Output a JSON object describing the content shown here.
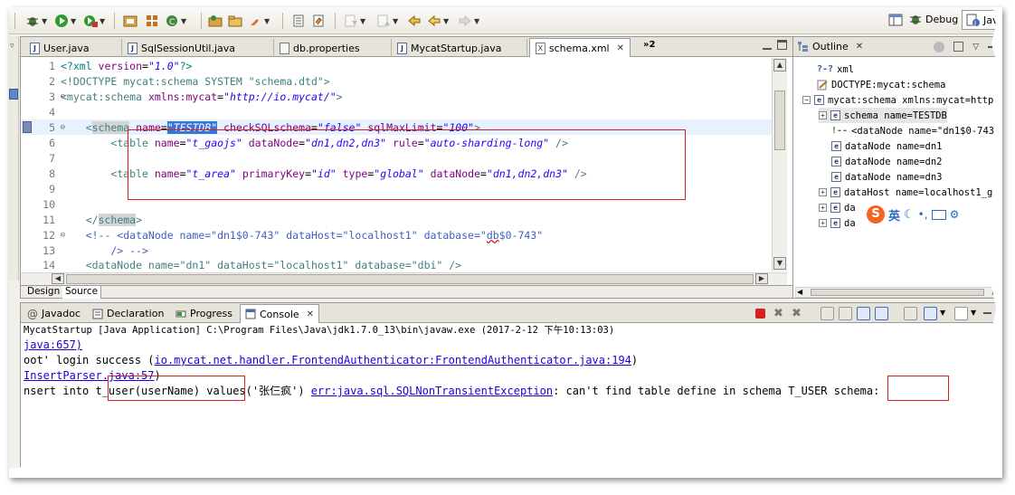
{
  "toolbar": {
    "perspective_debug_label": "Debug",
    "perspective_java_label": "Jav"
  },
  "editor": {
    "tabs": [
      {
        "label": "User.java",
        "icon": "java-file-icon"
      },
      {
        "label": "SqlSessionUtil.java",
        "icon": "java-file-icon"
      },
      {
        "label": "db.properties",
        "icon": "properties-file-icon"
      },
      {
        "label": "MycatStartup.java",
        "icon": "java-file-icon"
      },
      {
        "label": "schema.xml",
        "icon": "xml-file-icon",
        "active": true
      }
    ],
    "overflow_label": "»2",
    "bottom_tabs": {
      "design": "Design",
      "source": "Source"
    },
    "line_numbers": [
      "1",
      "2",
      "3",
      "4",
      "5",
      "6",
      "7",
      "8",
      "9",
      "10",
      "11",
      "12",
      "13",
      "14"
    ],
    "code": {
      "l1": {
        "pi_open": "<?xml ",
        "attr": "version",
        "eq": "=",
        "val": "\"1.0\"",
        "pi_close": "?>"
      },
      "l2": {
        "text": "<!DOCTYPE mycat:schema SYSTEM \"schema.dtd\">"
      },
      "l3": {
        "open": "<mycat:schema ",
        "attr": "xmlns:mycat",
        "eq": "=",
        "val": "\"http://io.mycat/\"",
        "close": ">"
      },
      "l5": {
        "indent": "    ",
        "open": "<",
        "tag": "schema",
        "a1": " name",
        "eq1": "=",
        "v1": "\"TESTDB\"",
        "a2": " checkSQLschema",
        "eq2": "=",
        "v2": "\"false\"",
        "a3": " sqlMaxLimit",
        "eq3": "=",
        "v3": "\"100\"",
        "close": ">"
      },
      "l6": {
        "indent": "        ",
        "open": "<table ",
        "a1": "name",
        "eq1": "=",
        "v1": "\"t_gaojs\"",
        "a2": " dataNode",
        "eq2": "=",
        "v2": "\"dn1,dn2,dn3\"",
        "a3": " rule",
        "eq3": "=",
        "v3": "\"auto-sharding-long\"",
        "close": " />"
      },
      "l8": {
        "indent": "        ",
        "open": "<table ",
        "a1": "name",
        "eq1": "=",
        "v1": "\"t_area\"",
        "a2": " primaryKey",
        "eq2": "=",
        "v2": "\"id\"",
        "a3": " type",
        "eq3": "=",
        "v3": "\"global\"",
        "a4": " dataNode",
        "eq4": "=",
        "v4": "\"dn1,dn2,dn3\"",
        "close": " />"
      },
      "l11": {
        "indent": "    ",
        "open": "</",
        "tag": "schema",
        "close": ">"
      },
      "l12": {
        "text1": "    <!-- <dataNode name=\"dn1$0-743\" dataHost=\"localhost1\" database=\"",
        "squig": "db",
        "text2": "$0-743\""
      },
      "l13": {
        "text": "        /> -->"
      },
      "l14": {
        "text": "    <dataNode name=\"dn1\" dataHost=\"localhost1\" database=\"dbi\" />"
      }
    }
  },
  "outline": {
    "title": "Outline",
    "items": [
      {
        "label": "xml",
        "icon": "processing-instruction-icon"
      },
      {
        "label": "DOCTYPE:mycat:schema",
        "icon": "doctype-icon"
      },
      {
        "label": "mycat:schema xmlns:mycat=http",
        "icon": "element-icon"
      },
      {
        "label": "schema name=TESTDB",
        "icon": "element-icon"
      },
      {
        "label": "<dataNode name=\"dn1$0-743\"",
        "icon": "comment-icon"
      },
      {
        "label": "dataNode name=dn1",
        "icon": "element-icon"
      },
      {
        "label": "dataNode name=dn2",
        "icon": "element-icon"
      },
      {
        "label": "dataNode name=dn3",
        "icon": "element-icon"
      },
      {
        "label": "dataHost name=localhost1_g",
        "icon": "element-icon"
      },
      {
        "label": "da",
        "icon": "element-icon"
      },
      {
        "label": "da",
        "icon": "element-icon"
      }
    ],
    "ime": {
      "mode": "英"
    }
  },
  "console": {
    "tabs": [
      {
        "label": "Javadoc",
        "icon": "javadoc-icon"
      },
      {
        "label": "Declaration",
        "icon": "declaration-icon"
      },
      {
        "label": "Progress",
        "icon": "progress-icon"
      },
      {
        "label": "Console",
        "icon": "console-icon",
        "active": true
      }
    ],
    "description": "MycatStartup [Java Application] C:\\Program Files\\Java\\jdk1.7.0_13\\bin\\javaw.exe (2017-2-12 下午10:13:03)",
    "lines": {
      "l1": {
        "link": "java:657)"
      },
      "l2": {
        "pre": "oot' login success  (",
        "link": "io.mycat.net.handler.FrontendAuthenticator:FrontendAuthenticator.java:194",
        "post": ")"
      },
      "l3": {
        "link": "InsertParser.java:57",
        "post": ")"
      },
      "l4": {
        "pre": "nsert into ",
        "table": "t_user(userName)",
        "mid": "  values('张仨疯') ",
        "err": "err:java.sql.SQLNonTransientException",
        "post": ": can't find table define in schema ",
        "schema": "T_USER",
        "tail": " schema:"
      }
    }
  }
}
